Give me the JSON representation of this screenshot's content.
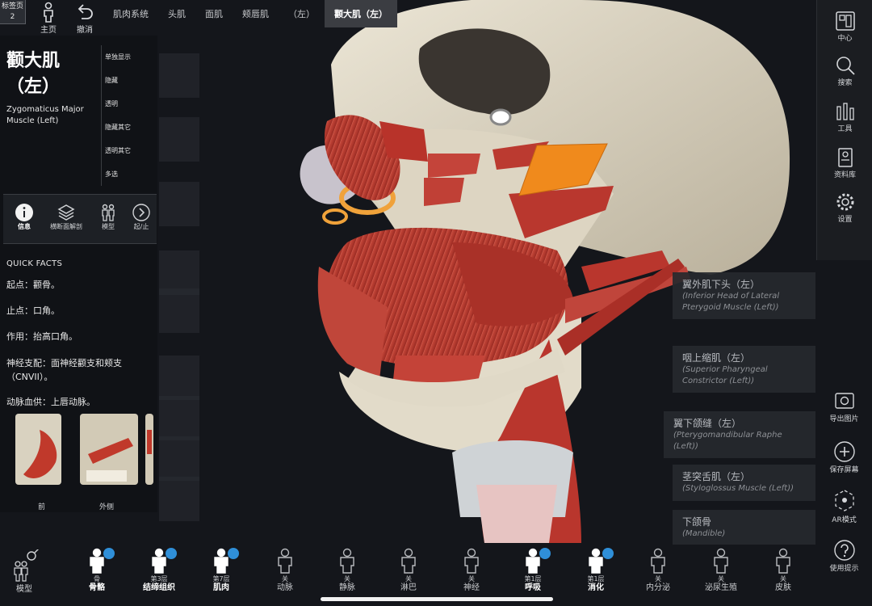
{
  "topbar": {
    "tab_badge_label": "标签页",
    "tab_badge_count": "2",
    "home_label": "主页",
    "undo_label": "撤消",
    "breadcrumbs": [
      "肌肉系统",
      "头肌",
      "面肌",
      "颊唇肌",
      "（左）",
      "颧大肌（左）"
    ]
  },
  "panel": {
    "title_cn": "颧大肌（左）",
    "title_en": "Zygomaticus Major Muscle (Left)",
    "context_menu": [
      "单独显示",
      "隐藏",
      "透明",
      "隐藏其它",
      "透明其它",
      "多选"
    ],
    "tabs": [
      {
        "icon": "info-icon",
        "label": "信息"
      },
      {
        "icon": "layers-icon",
        "label": "横断面解剖"
      },
      {
        "icon": "models-icon",
        "label": "模型"
      },
      {
        "icon": "chevron-right-icon",
        "label": "起/止"
      }
    ],
    "quick_facts_heading": "QUICK FACTS",
    "facts": [
      "起点：颧骨。",
      "止点：口角。",
      "作用：抬高口角。",
      "神经支配：面神经颧支和颊支（CNVII）。",
      "动脉血供：上唇动脉。"
    ],
    "thumbnails": [
      "前",
      "外侧"
    ]
  },
  "labels_right": [
    {
      "cn": "翼外肌下头（左）",
      "en": "(Inferior Head of Lateral Pterygoid Muscle (Left))"
    },
    {
      "cn": "咽上缩肌（左）",
      "en": "(Superior Pharyngeal Constrictor (Left))"
    },
    {
      "cn": "翼下颌缝（左）",
      "en": "(Pterygomandibular Raphe (Left))"
    },
    {
      "cn": "茎突舌肌（左）",
      "en": "(Styloglossus Muscle (Left))"
    },
    {
      "cn": "下颌骨",
      "en": "(Mandible)"
    }
  ],
  "right_toolbar": [
    {
      "icon": "center-icon",
      "label": "中心"
    },
    {
      "icon": "search-icon",
      "label": "搜索"
    },
    {
      "icon": "tools-icon",
      "label": "工具"
    },
    {
      "icon": "library-icon",
      "label": "资料库"
    },
    {
      "icon": "gear-icon",
      "label": "设置"
    }
  ],
  "right_actions": [
    {
      "icon": "camera-icon",
      "label": "导出图片"
    },
    {
      "icon": "plus-icon",
      "label": "保存屏幕"
    },
    {
      "icon": "ar-icon",
      "label": "AR模式"
    },
    {
      "icon": "help-icon",
      "label": "使用提示"
    }
  ],
  "bottom": {
    "model_label": "模型",
    "systems": [
      {
        "layer": "",
        "name": "骨\n骨骼",
        "top": "骨",
        "bottom": "骨骼",
        "active": true,
        "badge": true
      },
      {
        "top": "第3层",
        "bottom": "结缔组织",
        "active": true,
        "badge": true
      },
      {
        "top": "第7层",
        "bottom": "肌肉",
        "active": true,
        "badge": true
      },
      {
        "top": "关",
        "bottom": "动脉",
        "active": false,
        "badge": false
      },
      {
        "top": "关",
        "bottom": "静脉",
        "active": false,
        "badge": false
      },
      {
        "top": "关",
        "bottom": "淋巴",
        "active": false,
        "badge": false
      },
      {
        "top": "关",
        "bottom": "神经",
        "active": false,
        "badge": false
      },
      {
        "top": "第1层",
        "bottom": "呼吸",
        "active": true,
        "badge": true
      },
      {
        "top": "第1层",
        "bottom": "消化",
        "active": true,
        "badge": true
      },
      {
        "top": "关",
        "bottom": "内分泌",
        "active": false,
        "badge": false
      },
      {
        "top": "关",
        "bottom": "泌尿生殖",
        "active": false,
        "badge": false
      },
      {
        "top": "关",
        "bottom": "皮肤",
        "active": false,
        "badge": false
      }
    ]
  },
  "colors": {
    "muscle": "#b8322a",
    "bone": "#e4ddcc",
    "highlight": "#f08a1c",
    "background": "#14161b",
    "badge": "#2f8fd8"
  }
}
